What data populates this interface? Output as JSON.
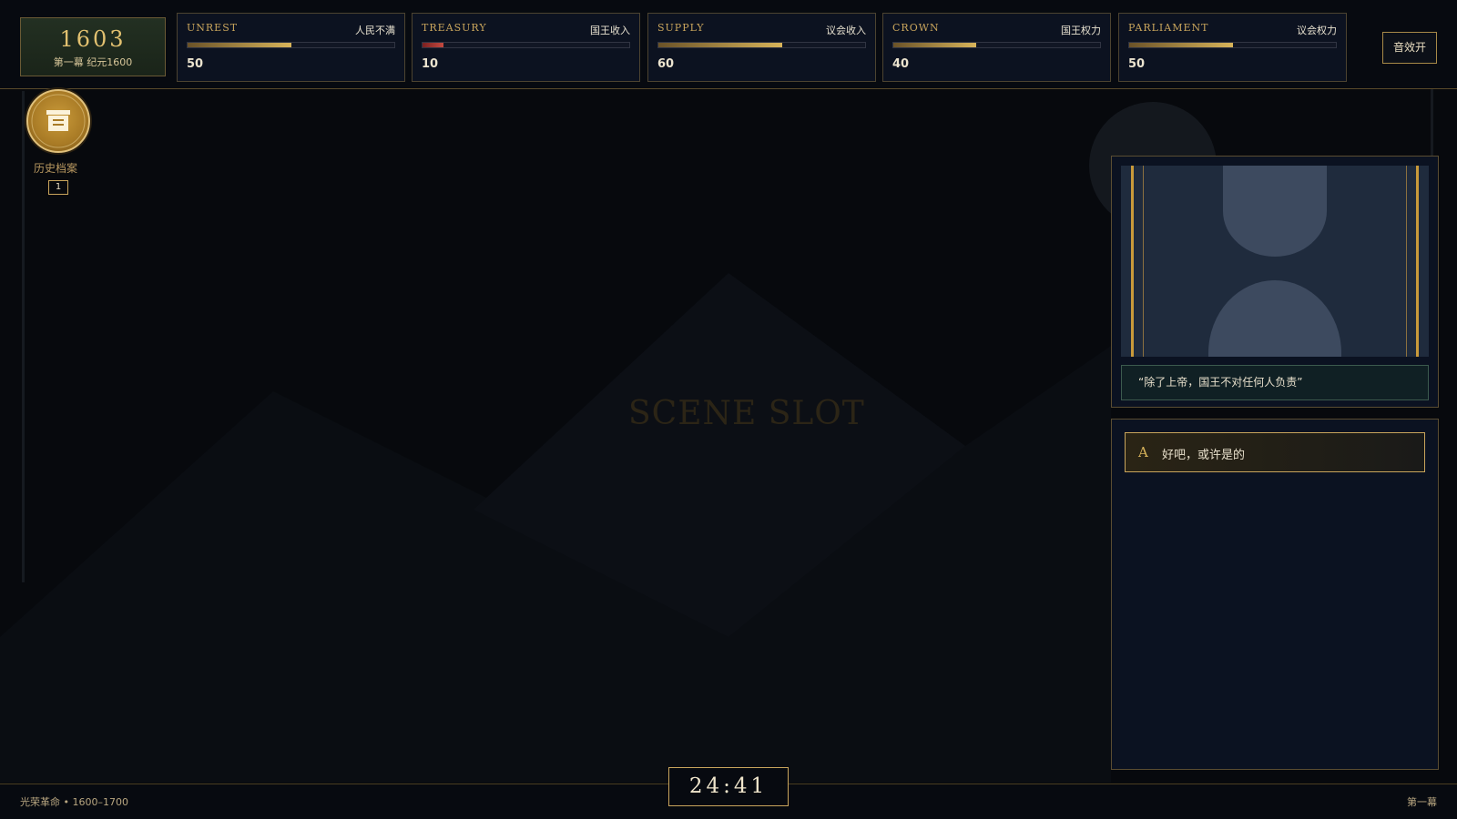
{
  "header": {
    "year": "1603",
    "act_era": "第一幕 纪元1600",
    "sound_button": "音效开"
  },
  "stats": [
    {
      "en": "UNREST",
      "cn": "人民不满",
      "value": 50,
      "value_text": "50",
      "color": "#d8b45a"
    },
    {
      "en": "TREASURY",
      "cn": "国王收入",
      "value": 10,
      "value_text": "10",
      "color": "#c44a40"
    },
    {
      "en": "SUPPLY",
      "cn": "议会收入",
      "value": 60,
      "value_text": "60",
      "color": "#d8b45a"
    },
    {
      "en": "CROWN",
      "cn": "国王权力",
      "value": 40,
      "value_text": "40",
      "color": "#d8b45a"
    },
    {
      "en": "PARLIAMENT",
      "cn": "议会权力",
      "value": 50,
      "value_text": "50",
      "color": "#d8b45a"
    }
  ],
  "archive": {
    "label": "历史档案",
    "count": "1",
    "icon": "archive-box-icon"
  },
  "scene": {
    "placeholder": "SCENE SLOT"
  },
  "portrait": {
    "quote": "“除了上帝，国王不对任何人负责”"
  },
  "choices": [
    {
      "letter": "A",
      "text": "好吧，或许是的"
    }
  ],
  "footer": {
    "era": "光荣革命 • 1600–1700",
    "act": "第一幕",
    "timer": "24:41"
  },
  "colors": {
    "accent_gold": "#c9a55c",
    "background": "#07090d",
    "panel": "#0b1221",
    "danger": "#c44a40"
  }
}
